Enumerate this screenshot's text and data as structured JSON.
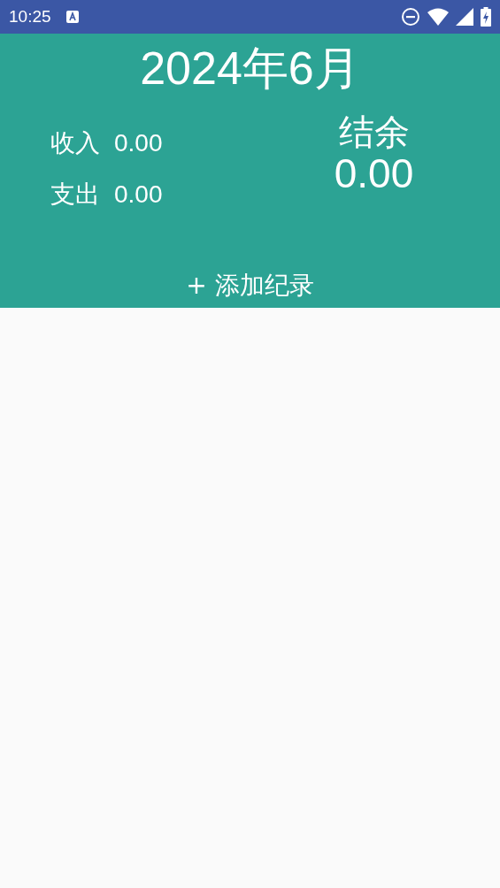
{
  "status_bar": {
    "time": "10:25"
  },
  "header": {
    "title": "2024年6月",
    "totals": [
      {
        "label": "收入",
        "value": "0.00"
      },
      {
        "label": "支出",
        "value": "0.00"
      }
    ],
    "balance": {
      "label": "结余",
      "value": "0.00"
    },
    "add_button": "+ 添加纪录"
  }
}
